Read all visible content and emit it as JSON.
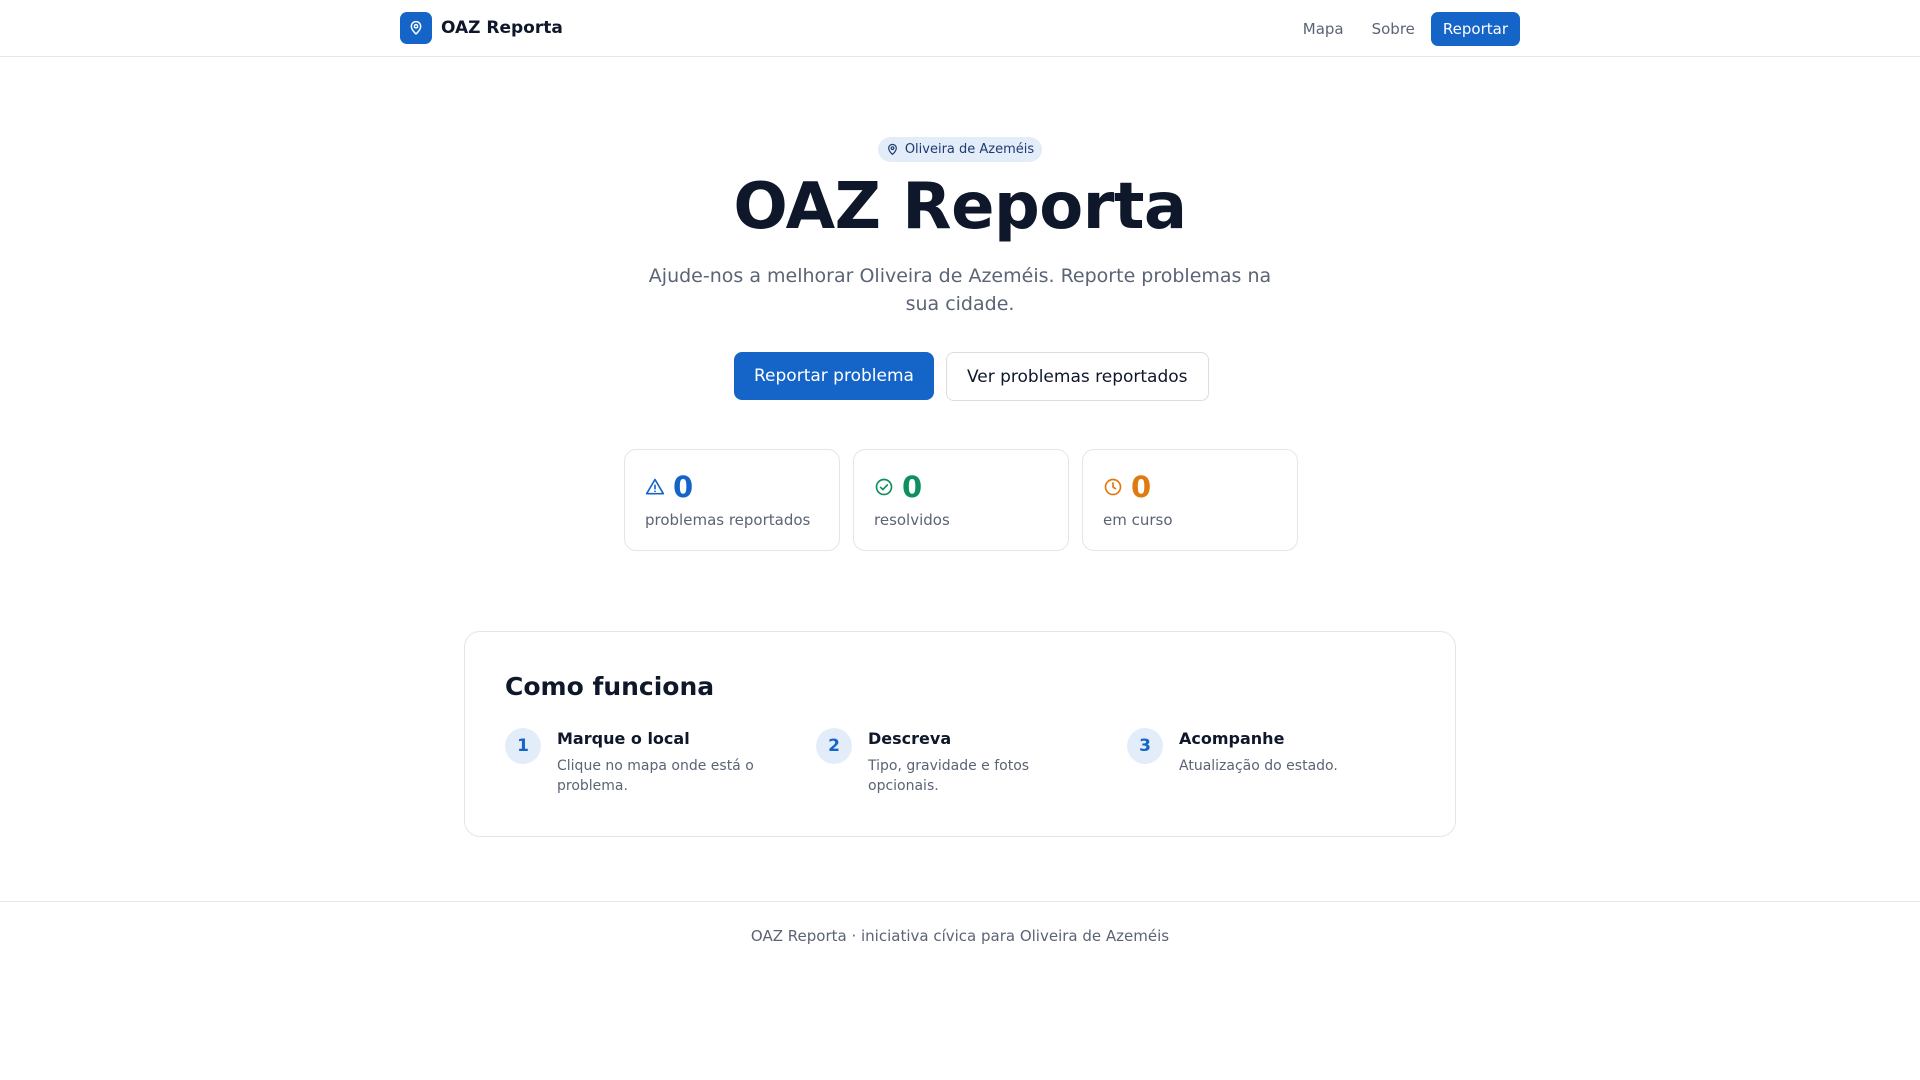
{
  "header": {
    "brand": "OAZ Reporta",
    "nav": {
      "map": "Mapa",
      "about": "Sobre",
      "report": "Reportar"
    }
  },
  "hero": {
    "location_badge": "Oliveira de Azeméis",
    "title": "OAZ Reporta",
    "subtitle": "Ajude-nos a melhorar Oliveira de Azeméis. Reporte problemas na sua cidade.",
    "primary_cta": "Reportar problema",
    "secondary_cta": "Ver problemas reportados"
  },
  "stats": [
    {
      "value": "0",
      "label": "problemas reportados",
      "icon": "warning-icon",
      "color": "#1565c8"
    },
    {
      "value": "0",
      "label": "resolvidos",
      "icon": "check-circle-icon",
      "color": "#0f8f5f"
    },
    {
      "value": "0",
      "label": "em curso",
      "icon": "clock-icon",
      "color": "#e07a10"
    }
  ],
  "how": {
    "title": "Como funciona",
    "steps": [
      {
        "num": "1",
        "title": "Marque o local",
        "desc": "Clique no mapa onde está o problema."
      },
      {
        "num": "2",
        "title": "Descreva",
        "desc": "Tipo, gravidade e fotos opcionais."
      },
      {
        "num": "3",
        "title": "Acompanhe",
        "desc": "Atualização do estado."
      }
    ]
  },
  "footer": {
    "text": "OAZ Reporta · iniciativa cívica para Oliveira de Azeméis"
  },
  "colors": {
    "accent": "#1565c8",
    "badge_bg": "#e3edf9"
  }
}
